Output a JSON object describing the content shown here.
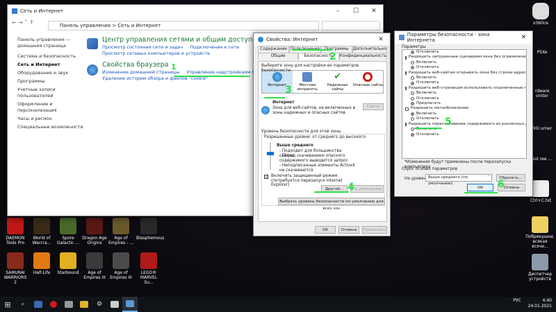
{
  "control_panel": {
    "title": "Сеть и Интернет",
    "breadcrumb": "Панель управления  >  Сеть и Интернет",
    "sidebar": [
      "Панель управления — домашняя страница",
      "Система и безопасность",
      "Сеть и Интернет",
      "Оборудование и звук",
      "Программы",
      "Учетные записи пользователей",
      "Оформление и персонализация",
      "Часы и регион",
      "Специальные возможности"
    ],
    "network_center": {
      "title": "Центр управления сетями и общим доступом",
      "links": [
        "Просмотр состояния сети и задач",
        "Подключение к сети",
        "Просмотр сетевых компьютеров и устройств"
      ]
    },
    "browser": {
      "title": "Свойства браузера",
      "links": [
        "Изменение домашней страницы",
        "Управление надстройками браузера",
        "Удаление истории обзора и файлов \"cookie\""
      ]
    }
  },
  "internet_options": {
    "title": "Свойства: Интернет",
    "tabs_row1": [
      "Содержание",
      "Подключения",
      "Программы",
      "Дополнительно"
    ],
    "tabs_row2": [
      "Общие",
      "Безопасность",
      "Конфиденциальность"
    ],
    "zone_prompt": "Выберите зону для настройки ее параметров безопасности.",
    "zones": [
      "Интернет",
      "Местная интрасеть",
      "Надежные сайты",
      "Опасные сайты"
    ],
    "zone_title": "Интернет",
    "zone_desc": "Зона для веб-сайтов, не включенных в зоны надежных и опасных сайтов.",
    "sites_button": "Сайты",
    "level_group": "Уровень безопасности для этой зоны",
    "level_allowed": "Разрешенные уровни: от среднего до высокого",
    "level_name": "Выше среднего",
    "level_bullets": [
      "- Подходит для большинства сайтов",
      "- Перед скачиванием опасного содержимого выводится запрос",
      "- Неподписанные элементы ActiveX не скачиваются"
    ],
    "protected_mode": "Включить защищенный режим (потребуется перезапуск Internet Explorer)",
    "custom_button": "Другой...",
    "default_button": "По умолчанию",
    "reset_all_button": "Выбрать уровень безопасности по умолчанию для всех зон",
    "ok": "ОК",
    "cancel": "Отмена",
    "apply": "Применить"
  },
  "security_settings": {
    "title": "Параметры безопасности - зона Интернета",
    "params_label": "Параметры",
    "items": [
      {
        "t": "radio",
        "on": true,
        "text": "Отключить"
      },
      {
        "t": "check",
        "text": "Разрешить запущенные сценарием окна без ограничений"
      },
      {
        "t": "radio",
        "on": false,
        "text": "Включить"
      },
      {
        "t": "radio",
        "on": true,
        "text": "Отключить"
      },
      {
        "t": "check",
        "text": "Разрешить веб-сайтам открывать окна без строки адреса"
      },
      {
        "t": "radio",
        "on": false,
        "text": "Включить"
      },
      {
        "t": "radio",
        "on": true,
        "text": "Отключить"
      },
      {
        "t": "check",
        "text": "Разрешить веб-страницам использовать ограниченные пр"
      },
      {
        "t": "radio",
        "on": false,
        "text": "Включить"
      },
      {
        "t": "radio",
        "on": false,
        "text": "Отключить"
      },
      {
        "t": "radio",
        "on": true,
        "text": "Предлагать"
      },
      {
        "t": "check",
        "text": "Разрешить метаобновление"
      },
      {
        "t": "radio",
        "on": true,
        "text": "Включить"
      },
      {
        "t": "radio",
        "on": false,
        "text": "Отключить"
      },
      {
        "t": "check",
        "text": "Разрешить перетаскивание содержимого из различных д"
      },
      {
        "t": "radio",
        "on": false,
        "text": "Включить"
      },
      {
        "t": "radio",
        "on": true,
        "text": "Отключить"
      }
    ],
    "restart_note": "*Изменения будут применены после перезапуска компьютера",
    "reset_group": "Сброс особых параметров",
    "reset_to_label": "На уровень:",
    "reset_select": "Выше среднего (по умолчанию)",
    "reset_button": "Сбросить...",
    "ok": "ОК",
    "cancel": "Отмена"
  },
  "annotations": [
    "1",
    "2",
    "3",
    "4",
    "5",
    "6"
  ],
  "desktop_icons_left": [
    "DAEMON Tools Pro",
    "World of Warcra...",
    "Spore Galactic ...",
    "Dragon Age Origins",
    "Age of Empires - ...",
    "Blasphemous",
    "SAMURAI WARRIORS 2",
    "Half-Life",
    "Starbound",
    "Age of Empires III",
    "Age of Empires III",
    "LEGO® MARVEL Su..."
  ],
  "desktop_icons_right": [
    "x360ce",
    "PSXe",
    "rdware onitor",
    "NSI urner",
    "ast ree ...",
    "Ctrl+C.txt",
    "Побрякушки, всякая всячи...",
    "Диспетчер устройств"
  ],
  "taskbar": {
    "lang": "РУС",
    "time": "4:40",
    "date": "24.01.2021"
  }
}
